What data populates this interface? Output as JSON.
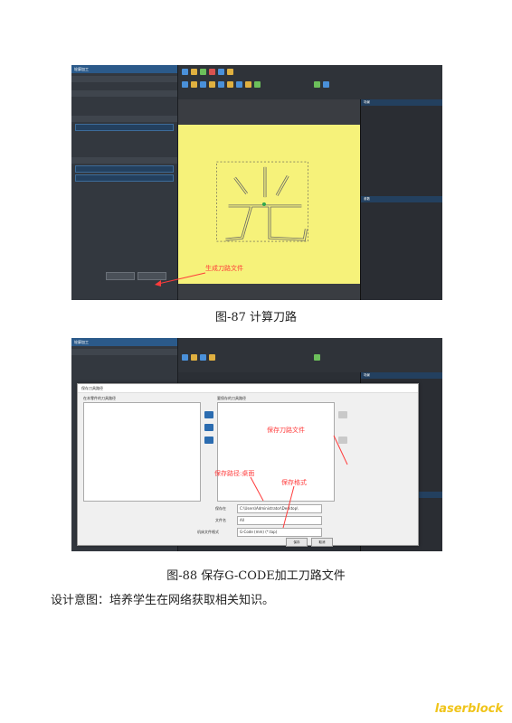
{
  "figure1": {
    "caption": "图-87 计算刀路",
    "annotation": "生成刀路文件",
    "left_panel_title": "轮廓加工",
    "tree_title": "场景",
    "props_title": "参数"
  },
  "figure2": {
    "caption": "图-88 保存G-CODE加工刀路文件",
    "dialog_title": "保存刀具路径",
    "annotation_file": "保存刀路文件",
    "annotation_path": "保存路径:桌面",
    "annotation_format": "保存格式",
    "save_in_label": "保存在",
    "save_in_value": "C:\\Users\\Administrator\\Desktop\\",
    "filename_label": "文件名",
    "filename_value": "All",
    "format_label": "机床文件格式",
    "format_value": "G-Code (mm) (*.tap)",
    "save_button": "保存",
    "cancel_button": "取消",
    "left_list_header": "在本零件的刀具路径",
    "right_list_header": "要保存的刀具路径"
  },
  "design_intent": "设计意图：培养学生在网络获取相关知识。",
  "brand": "laserblock",
  "colors": {
    "canvas": "#f6f27a",
    "annotation": "#ff3b3b",
    "brand": "#f0c419"
  }
}
